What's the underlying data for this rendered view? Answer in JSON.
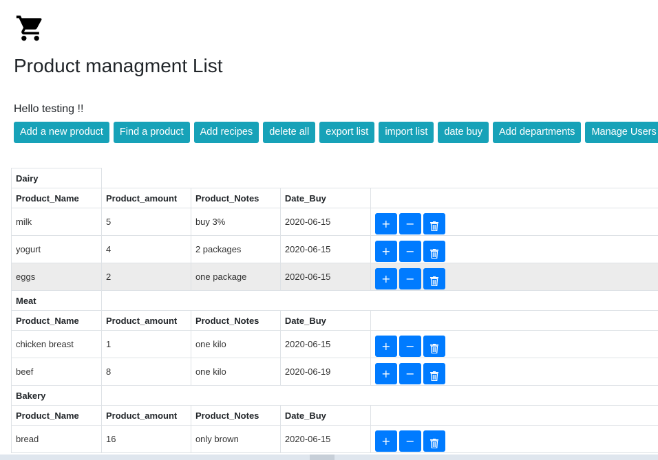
{
  "header": {
    "icon": "shopping-cart-icon",
    "title": "Product managment List",
    "greeting": "Hello testing !!"
  },
  "toolbar": {
    "color": "#17a2b8",
    "buttons": [
      {
        "id": "add-product",
        "label": "Add a new product"
      },
      {
        "id": "find-product",
        "label": "Find a product"
      },
      {
        "id": "add-recipes",
        "label": "Add recipes"
      },
      {
        "id": "delete-all",
        "label": "delete all"
      },
      {
        "id": "export-list",
        "label": "export list"
      },
      {
        "id": "import-list",
        "label": "import list"
      },
      {
        "id": "date-buy",
        "label": "date buy"
      },
      {
        "id": "add-departments",
        "label": "Add departments"
      },
      {
        "id": "manage-users",
        "label": "Manage Users"
      }
    ]
  },
  "columns": [
    "Product_Name",
    "Product_amount",
    "Product_Notes",
    "Date_Buy"
  ],
  "action_buttons": {
    "plus": "+",
    "minus": "−",
    "delete_icon": "trash-icon",
    "color": "#007bff"
  },
  "departments": [
    {
      "name": "Dairy",
      "items": [
        {
          "name": "milk",
          "amount": "5",
          "notes": "buy 3%",
          "date": "2020-06-15"
        },
        {
          "name": "yogurt",
          "amount": "4",
          "notes": "2 packages",
          "date": "2020-06-15"
        },
        {
          "name": "eggs",
          "amount": "2",
          "notes": "one package",
          "date": "2020-06-15",
          "highlighted": true
        }
      ]
    },
    {
      "name": "Meat",
      "items": [
        {
          "name": "chicken breast",
          "amount": "1",
          "notes": "one kilo",
          "date": "2020-06-15"
        },
        {
          "name": "beef",
          "amount": "8",
          "notes": "one kilo",
          "date": "2020-06-19"
        }
      ]
    },
    {
      "name": "Bakery",
      "items": [
        {
          "name": "bread",
          "amount": "16",
          "notes": "only brown",
          "date": "2020-06-15"
        }
      ]
    }
  ]
}
